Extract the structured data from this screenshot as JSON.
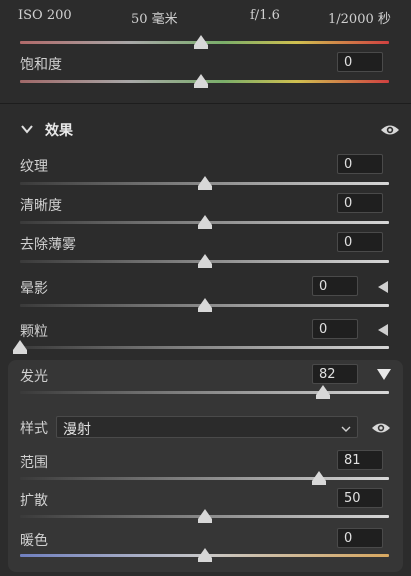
{
  "camera_info": {
    "iso": "ISO 200",
    "focal_length": "50 毫米",
    "aperture": "f/1.6",
    "shutter": "1/2000 秒"
  },
  "top_slider": {
    "value_fraction": 0.49
  },
  "saturation": {
    "label": "饱和度",
    "value": "0",
    "value_fraction": 0.49
  },
  "effects": {
    "title": "效果",
    "texture": {
      "label": "纹理",
      "value": "0",
      "value_fraction": 0.5
    },
    "clarity": {
      "label": "清晰度",
      "value": "0",
      "value_fraction": 0.5
    },
    "dehaze": {
      "label": "去除薄雾",
      "value": "0",
      "value_fraction": 0.5
    },
    "vignette": {
      "label": "晕影",
      "value": "0",
      "value_fraction": 0.5
    },
    "grain": {
      "label": "颗粒",
      "value": "0",
      "value_fraction": 0.0
    },
    "glow": {
      "label": "发光",
      "value": "82",
      "value_fraction": 0.82,
      "style_label": "样式",
      "style_value": "漫射",
      "range": {
        "label": "范围",
        "value": "81",
        "value_fraction": 0.81
      },
      "spread": {
        "label": "扩散",
        "value": "50",
        "value_fraction": 0.5
      },
      "warmth": {
        "label": "暖色",
        "value": "0",
        "value_fraction": 0.5
      }
    }
  },
  "colors": {
    "background": "#2c2c2c",
    "panel": "#363636",
    "hue_gradient": [
      "#b36b6b",
      "#b0b0b0",
      "#6fae6f",
      "#d0c050",
      "#d04040"
    ],
    "warmth_gradient": [
      "#7080c0",
      "#c0c0c0",
      "#d8a860"
    ]
  }
}
